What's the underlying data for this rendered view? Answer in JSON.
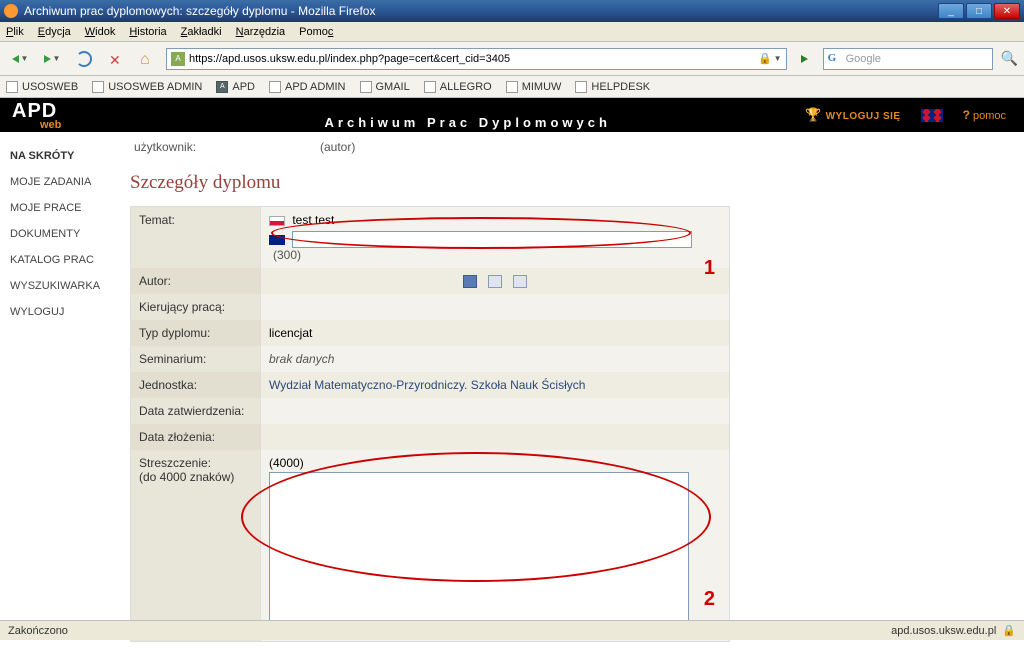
{
  "window": {
    "title": "Archiwum prac dyplomowych: szczegóły dyplomu - Mozilla Firefox"
  },
  "menu": {
    "items": [
      "Plik",
      "Edycja",
      "Widok",
      "Historia",
      "Zakładki",
      "Narzędzia",
      "Pomoc"
    ]
  },
  "nav": {
    "url": "https://apd.usos.uksw.edu.pl/index.php?page=cert&cert_cid=3405",
    "search_placeholder": "Google"
  },
  "bookmarks": [
    "USOSWEB",
    "USOSWEB ADMIN",
    "APD",
    "APD ADMIN",
    "GMAIL",
    "ALLEGRO",
    "MIMUW",
    "HELPDESK"
  ],
  "apdbar": {
    "logo1": "APD",
    "logo2": "web",
    "title": "Archiwum Prac Dyplomowych",
    "logout": "WYLOGUJ SIĘ",
    "help": "pomoc"
  },
  "sidebar": {
    "header": "NA SKRÓTY",
    "items": [
      "MOJE ZADANIA",
      "MOJE PRACE",
      "DOKUMENTY",
      "KATALOG PRAC",
      "WYSZUKIWARKA",
      "WYLOGUJ"
    ]
  },
  "content": {
    "user_label": "użytkownik:",
    "user_role": "(autor)",
    "page_title": "Szczegóły dyplomu",
    "rows": {
      "temat": {
        "label": "Temat:",
        "pl_value": "test test",
        "en_value": "",
        "limit": "(300)"
      },
      "autor": {
        "label": "Autor:"
      },
      "kierujacy": {
        "label": "Kierujący pracą:"
      },
      "typ": {
        "label": "Typ dyplomu:",
        "value": "licencjat"
      },
      "seminarium": {
        "label": "Seminarium:",
        "value": "brak danych"
      },
      "jednostka": {
        "label": "Jednostka:",
        "value": "Wydział Matematyczno-Przyrodniczy. Szkoła Nauk Ścisłych"
      },
      "data_zatw": {
        "label": "Data zatwierdzenia:"
      },
      "data_zloz": {
        "label": "Data złożenia:"
      },
      "streszczenie": {
        "label": "Streszczenie:",
        "sub": "(do 4000 znaków)",
        "limit": "(4000)",
        "value": ""
      }
    },
    "annotations": {
      "a1": "1",
      "a2": "2"
    }
  },
  "status": {
    "left": "Zakończono",
    "right": "apd.usos.uksw.edu.pl"
  }
}
